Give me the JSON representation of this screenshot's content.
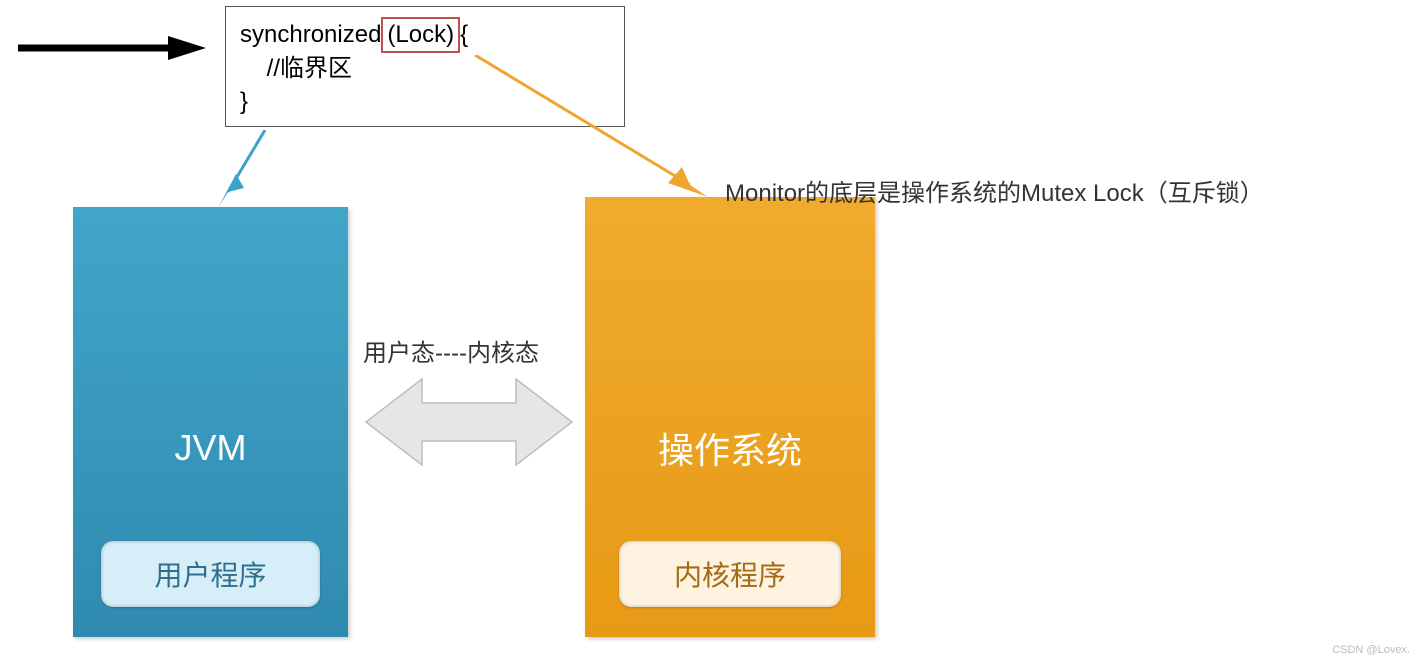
{
  "code": {
    "line1_pre": "synchronized",
    "line1_lock": "(Lock)",
    "line1_post": "{",
    "line2": "    //临界区",
    "line3": "}"
  },
  "jvm": {
    "title": "JVM",
    "pill": "用户程序"
  },
  "os": {
    "title": "操作系统",
    "pill": "内核程序"
  },
  "middle_label": "用户态----内核态",
  "monitor_note": "Monitor的底层是操作系统的Mutex Lock（互斥锁）",
  "watermark": "CSDN @Lovex."
}
